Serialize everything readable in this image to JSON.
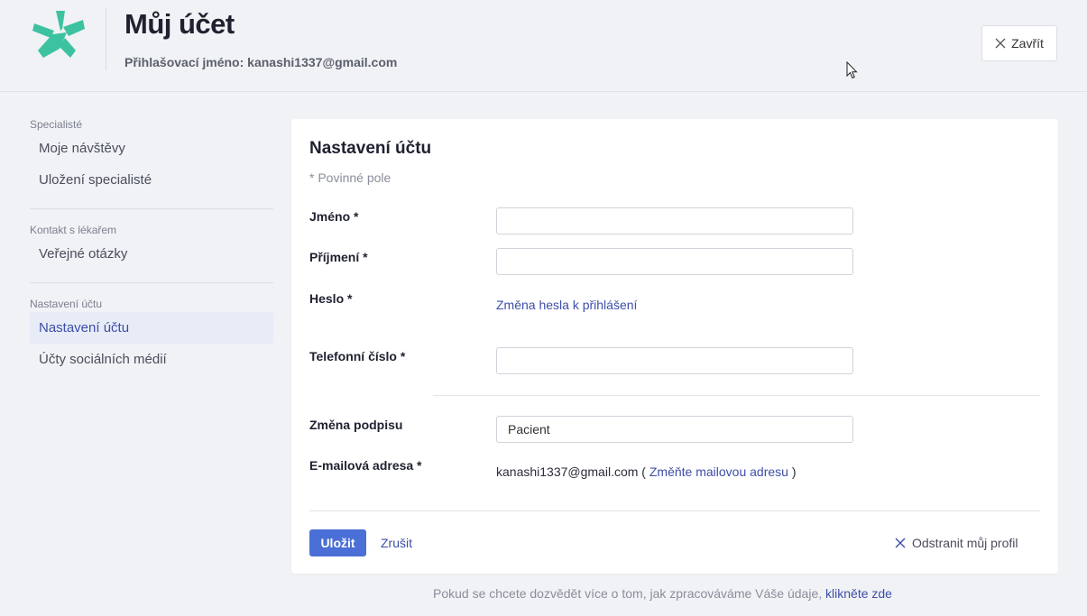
{
  "header": {
    "title": "Můj účet",
    "login_label": "Přihlašovací jméno: kanashi1337@gmail.com",
    "close_label": "Zavřít",
    "brand_color": "#3cc2a0"
  },
  "sidebar": {
    "sections": [
      {
        "label": "Specialisté",
        "items": [
          "Moje návštěvy",
          "Uložení specialisté"
        ]
      },
      {
        "label": "Kontakt s lékařem",
        "items": [
          "Veřejné otázky"
        ]
      },
      {
        "label": "Nastavení účtu",
        "items": [
          "Nastavení účtu",
          "Účty sociálních médií"
        ]
      }
    ],
    "active_item": "Nastavení účtu"
  },
  "form": {
    "title": "Nastavení účtu",
    "required_note": "* Povinné pole",
    "first_name": {
      "label": "Jméno *",
      "value": ""
    },
    "last_name": {
      "label": "Příjmení *",
      "value": ""
    },
    "password": {
      "label": "Heslo *",
      "link": "Změna hesla k přihlášení"
    },
    "phone": {
      "label": "Telefonní číslo *",
      "value": ""
    },
    "signature": {
      "label": "Změna podpisu",
      "value": "Pacient"
    },
    "email": {
      "label": "E-mailová adresa *",
      "value": "kanashi1337@gmail.com",
      "open_paren": "(",
      "change_link": "Změňte mailovou adresu",
      "close_paren": ")"
    },
    "save_label": "Uložit",
    "cancel_label": "Zrušit",
    "delete_label": "Odstranit můj profil"
  },
  "footer": {
    "privacy_text": "Pokud se chcete dozvědět více o tom, jak zpracováváme Váše údaje,",
    "privacy_link": "klikněte zde"
  },
  "colors": {
    "accent": "#4a6fd6",
    "link": "#3d4ea8",
    "background": "#f0f2f5"
  }
}
